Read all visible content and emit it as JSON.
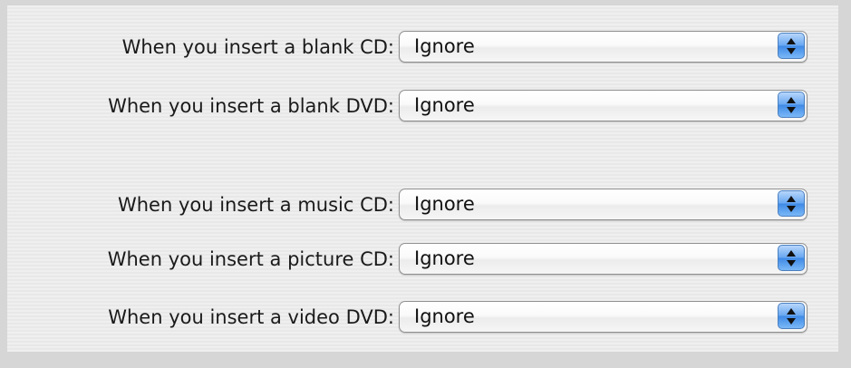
{
  "rows": [
    {
      "label": "When you insert a blank CD:",
      "value": "Ignore"
    },
    {
      "label": "When you insert a blank DVD:",
      "value": "Ignore"
    },
    {
      "label": "When you insert a music CD:",
      "value": "Ignore"
    },
    {
      "label": "When you insert a picture CD:",
      "value": "Ignore"
    },
    {
      "label": "When you insert a video DVD:",
      "value": "Ignore"
    }
  ],
  "icons": {
    "popup_arrows": "up-down-arrows-icon"
  },
  "colors": {
    "stepper_accent": "#5a9cec",
    "background": "#d6d6d6",
    "panel": "#ececec"
  }
}
